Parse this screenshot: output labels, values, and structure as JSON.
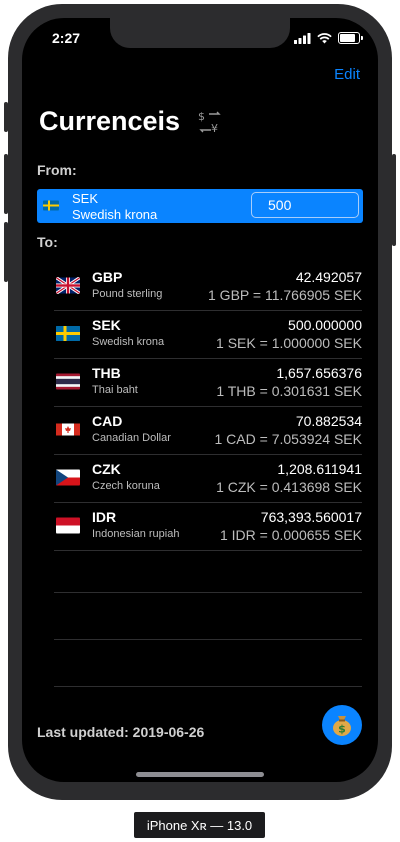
{
  "status_bar": {
    "time": "2:27"
  },
  "nav": {
    "edit_label": "Edit"
  },
  "page": {
    "title": "Currenceis"
  },
  "from": {
    "label": "From:",
    "code": "SEK",
    "name": "Swedish krona",
    "amount": "500"
  },
  "to": {
    "label": "To:",
    "items": [
      {
        "code": "GBP",
        "name": "Pound sterling",
        "value": "42.492057",
        "rate": "1 GBP = 11.766905 SEK",
        "flag": "gb"
      },
      {
        "code": "SEK",
        "name": "Swedish krona",
        "value": "500.000000",
        "rate": "1 SEK = 1.000000 SEK",
        "flag": "se"
      },
      {
        "code": "THB",
        "name": "Thai baht",
        "value": "1,657.656376",
        "rate": "1 THB = 0.301631 SEK",
        "flag": "th"
      },
      {
        "code": "CAD",
        "name": "Canadian Dollar",
        "value": "70.882534",
        "rate": "1 CAD = 7.053924 SEK",
        "flag": "ca"
      },
      {
        "code": "CZK",
        "name": "Czech koruna",
        "value": "1,208.611941",
        "rate": "1 CZK = 0.413698 SEK",
        "flag": "cz"
      },
      {
        "code": "IDR",
        "name": "Indonesian rupiah",
        "value": "763,393.560017",
        "rate": "1 IDR = 0.000655 SEK",
        "flag": "id"
      }
    ]
  },
  "footer": {
    "last_updated": "Last updated: 2019-06-26"
  },
  "simulator": {
    "device_label": "iPhone Xʀ — 13.0"
  },
  "colors": {
    "accent": "#0a84ff",
    "background": "#000000"
  }
}
